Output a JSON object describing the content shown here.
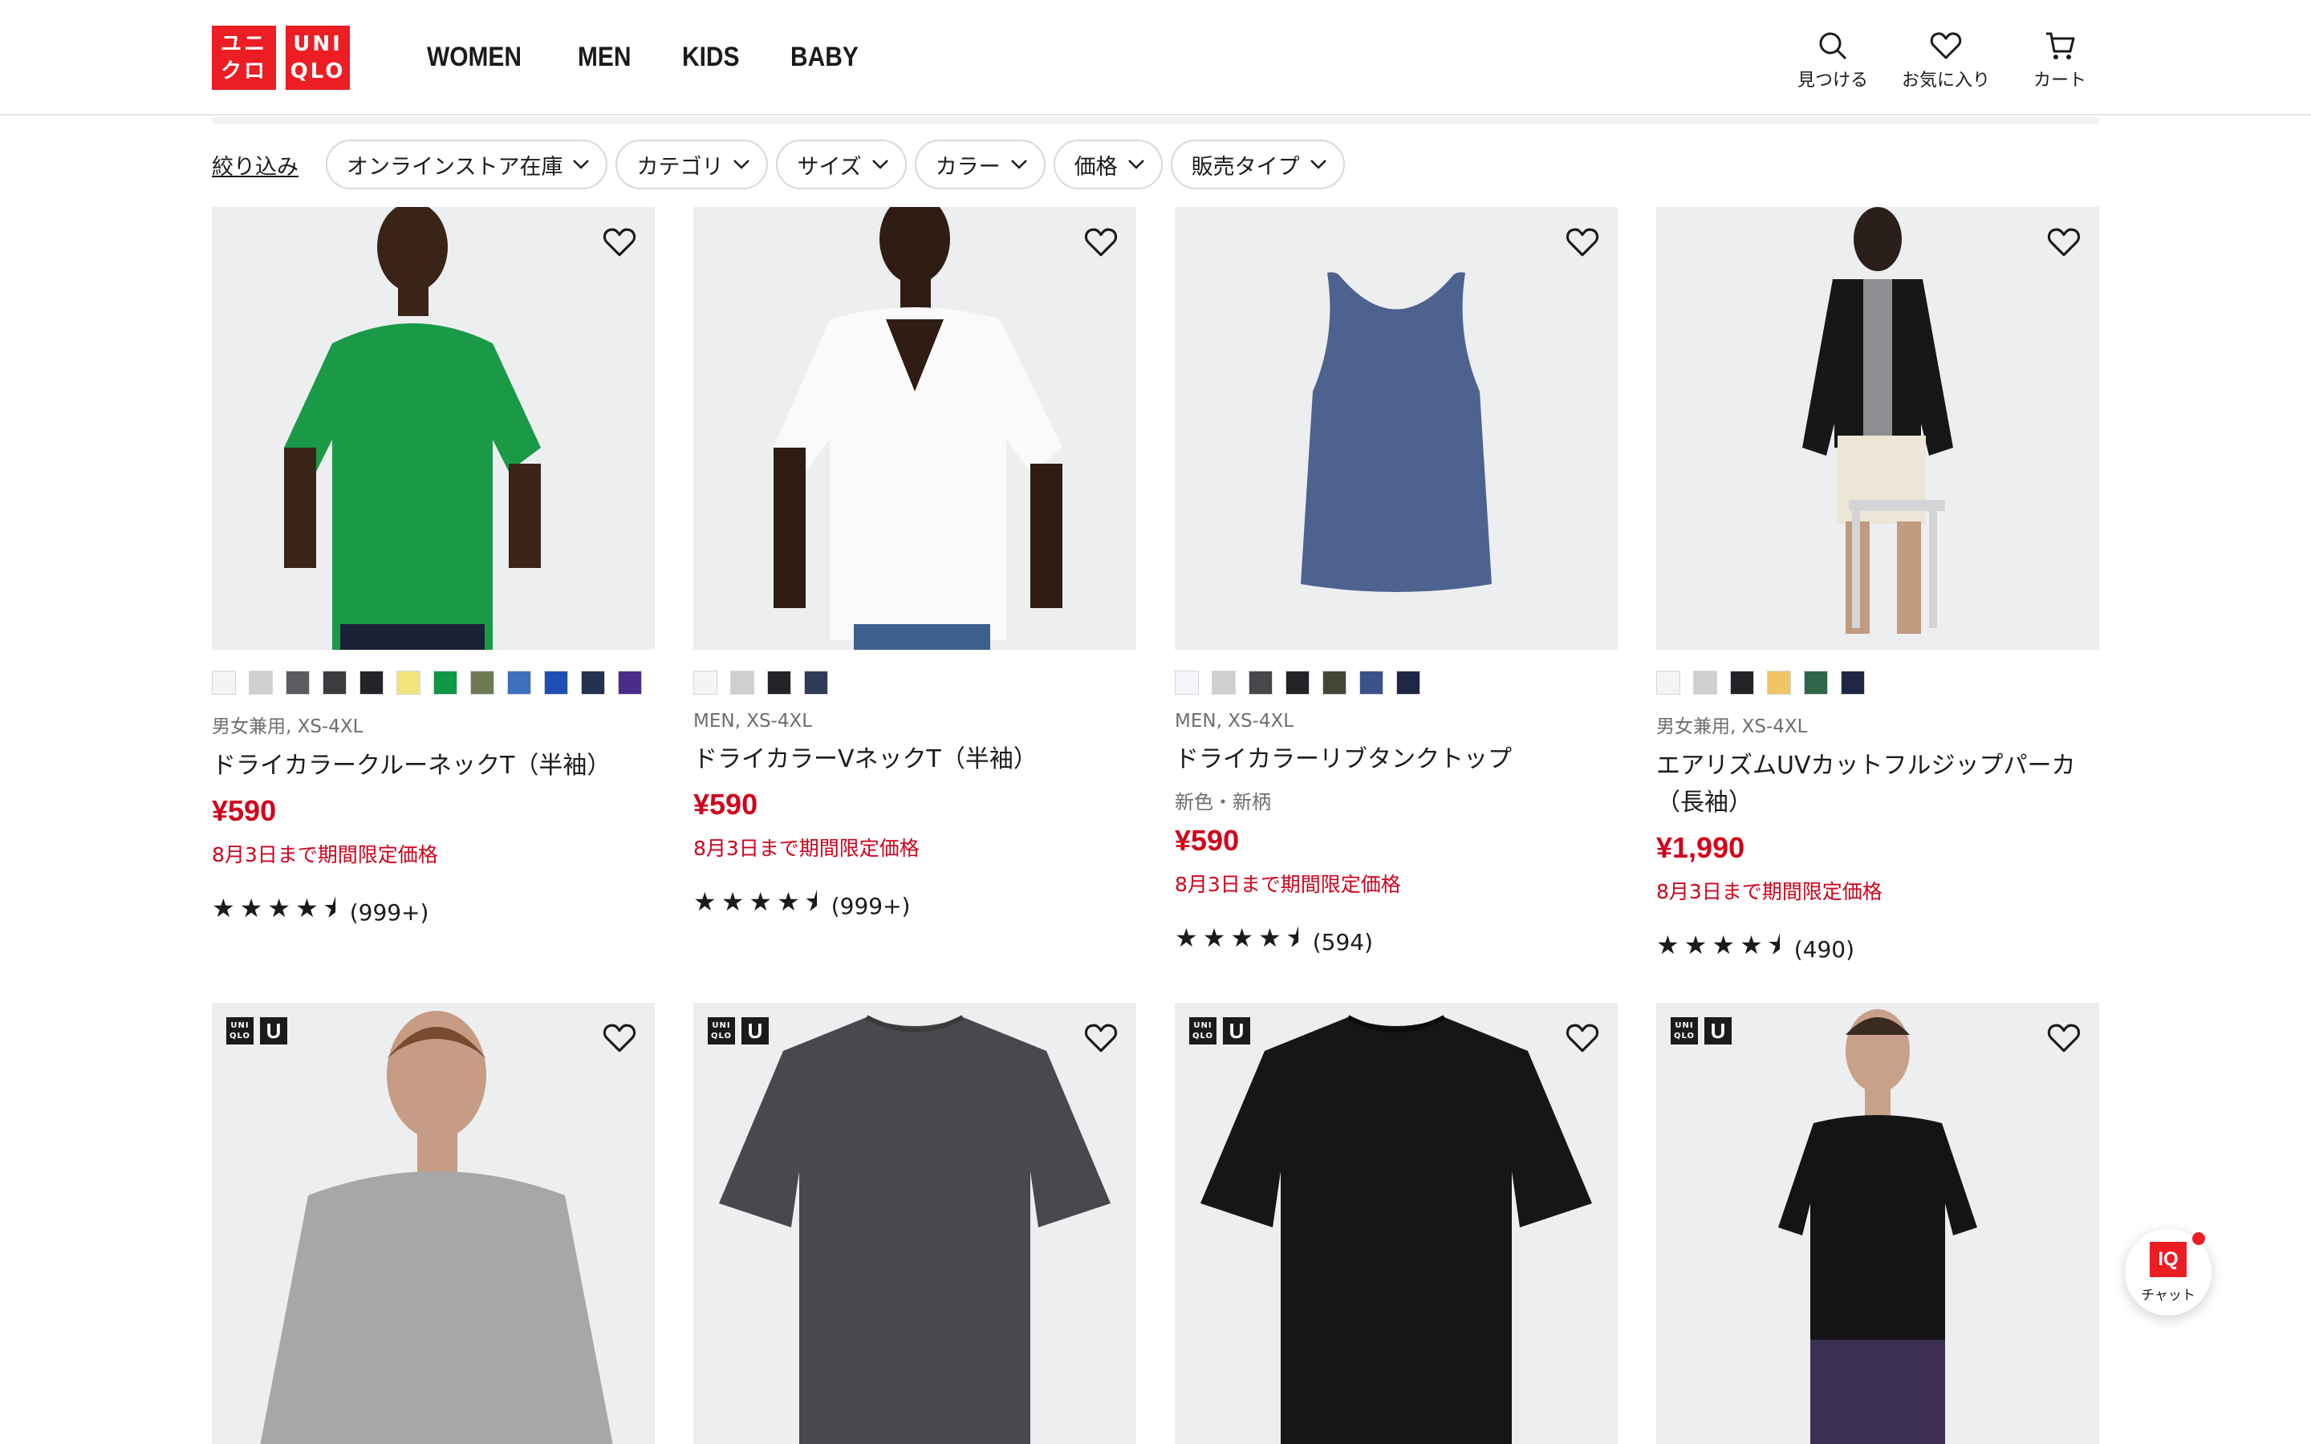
{
  "header": {
    "logo_top": "ユニ",
    "logo_bottom": "クロ",
    "logo2_top": "UNI",
    "logo2_bottom": "QLO",
    "nav": [
      "WOMEN",
      "MEN",
      "KIDS",
      "BABY"
    ],
    "search_label": "見つける",
    "favorites_label": "お気に入り",
    "cart_label": "カート"
  },
  "filters": {
    "refine_label": "絞り込み",
    "chips": [
      "オンラインストア在庫",
      "カテゴリ",
      "サイズ",
      "カラー",
      "価格",
      "販売タイプ"
    ]
  },
  "products": [
    {
      "swatches": [
        "#f4f4f4",
        "#cfcfd1",
        "#5b5c60",
        "#3b3c3f",
        "#232427",
        "#f2e37d",
        "#0e9747",
        "#6f7a54",
        "#3f6fbf",
        "#1f4fb5",
        "#24314f",
        "#4c2c8a"
      ],
      "meta": "男女兼用, XS-4XL",
      "title": "ドライカラークルーネックT（半袖）",
      "note": "",
      "price": "¥590",
      "promo": "8月3日まで期間限定価格",
      "stars": "★★★★⯨",
      "reviews": "(999+)"
    },
    {
      "swatches": [
        "#f4f4f4",
        "#cfcfd1",
        "#232427",
        "#2f3a56"
      ],
      "meta": "MEN, XS-4XL",
      "title": "ドライカラーVネックT（半袖）",
      "note": "",
      "price": "¥590",
      "promo": "8月3日まで期間限定価格",
      "stars": "★★★★⯨",
      "reviews": "(999+)"
    },
    {
      "swatches": [
        "#f4f6fb",
        "#cfcfd1",
        "#46484c",
        "#232427",
        "#434636",
        "#3d5189",
        "#1f2744"
      ],
      "meta": "MEN, XS-4XL",
      "title": "ドライカラーリブタンクトップ",
      "note": "新色・新柄",
      "price": "¥590",
      "promo": "8月3日まで期間限定価格",
      "stars": "★★★★⯨",
      "reviews": "(594)"
    },
    {
      "swatches": [
        "#f4f4f4",
        "#cfcfd1",
        "#232427",
        "#f0c566",
        "#2f6648",
        "#1f2744"
      ],
      "meta": "男女兼用, XS-4XL",
      "title": "エアリズムUVカットフルジップパーカ（長袖）",
      "note": "",
      "price": "¥1,990",
      "promo": "8月3日まで期間限定価格",
      "stars": "★★★★⯨",
      "reviews": "(490)"
    }
  ],
  "badge": {
    "uq_top": "UNI",
    "uq_bottom": "QLO",
    "u": "U"
  },
  "chat": {
    "iq": "IQ",
    "label": "チャット"
  }
}
